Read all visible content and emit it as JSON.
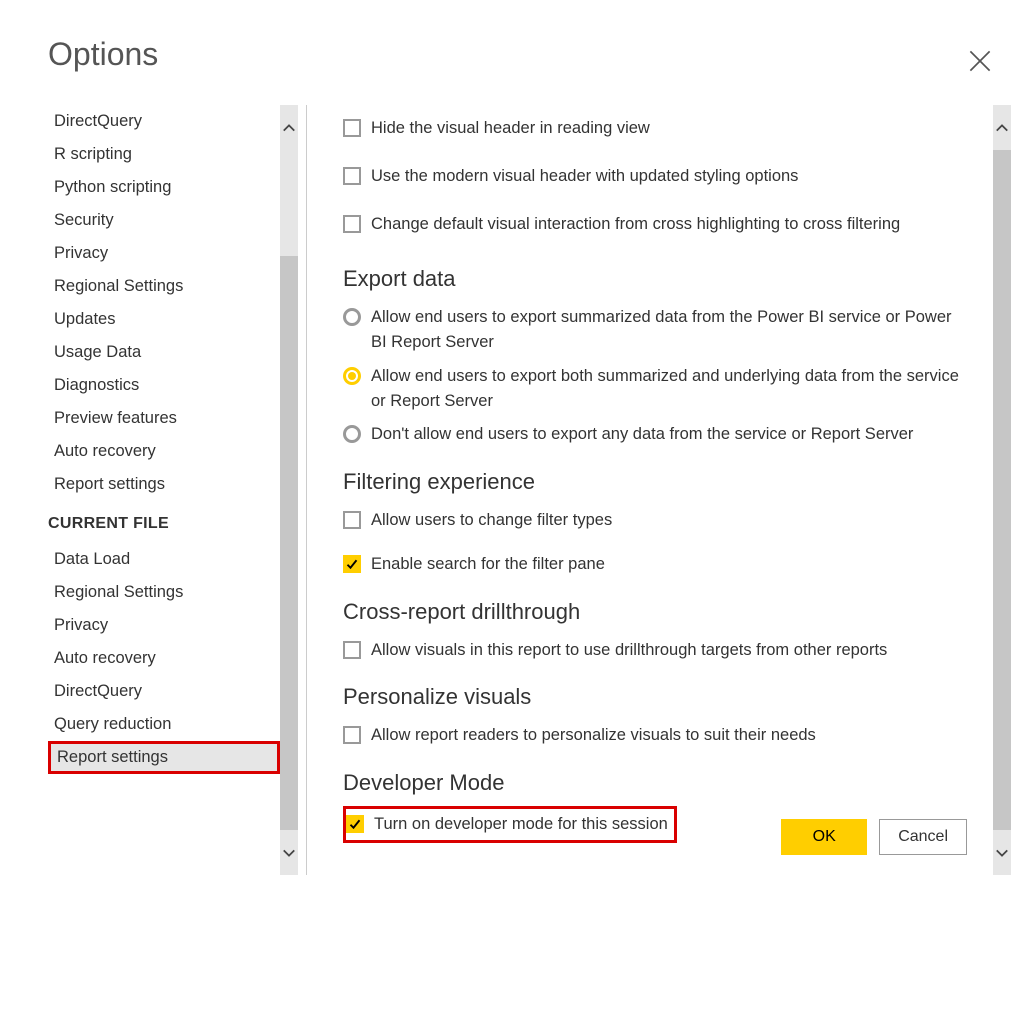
{
  "title": "Options",
  "sidebar": {
    "items_a": [
      "DirectQuery",
      "R scripting",
      "Python scripting",
      "Security",
      "Privacy",
      "Regional Settings",
      "Updates",
      "Usage Data",
      "Diagnostics",
      "Preview features",
      "Auto recovery",
      "Report settings"
    ],
    "section_b": "CURRENT FILE",
    "items_b": [
      "Data Load",
      "Regional Settings",
      "Privacy",
      "Auto recovery",
      "DirectQuery",
      "Query reduction",
      "Report settings"
    ]
  },
  "content": {
    "visual_opts": {
      "hide_header": "Hide the visual header in reading view",
      "modern_header": "Use the modern visual header with updated styling options",
      "cross_filter": "Change default visual interaction from cross highlighting to cross filtering"
    },
    "export": {
      "title": "Export data",
      "opt_summ": "Allow end users to export summarized data from the Power BI service or Power BI Report Server",
      "opt_both": "Allow end users to export both summarized and underlying data from the service or Report Server",
      "opt_none": "Don't allow end users to export any data from the service or Report Server"
    },
    "filtering": {
      "title": "Filtering experience",
      "change_types": "Allow users to change filter types",
      "enable_search": "Enable search for the filter pane"
    },
    "drill": {
      "title": "Cross-report drillthrough",
      "allow": "Allow visuals in this report to use drillthrough targets from other reports"
    },
    "personalize": {
      "title": "Personalize visuals",
      "allow": "Allow report readers to personalize visuals to suit their needs"
    },
    "developer": {
      "title": "Developer Mode",
      "turn_on": "Turn on developer mode for this session"
    }
  },
  "buttons": {
    "ok": "OK",
    "cancel": "Cancel"
  }
}
